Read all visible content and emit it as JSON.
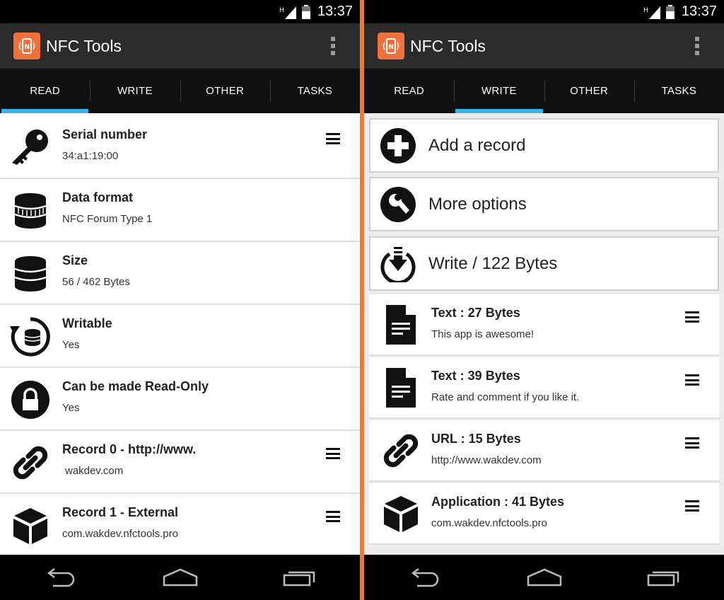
{
  "status": {
    "time": "13:37"
  },
  "app": {
    "title": "NFC Tools",
    "accent": "#f0713a",
    "tab_indicator": "#33b5e5"
  },
  "tabs": [
    "READ",
    "WRITE",
    "OTHER",
    "TASKS"
  ],
  "read_screen": {
    "active_tab": "READ",
    "rows": [
      {
        "icon": "key-icon",
        "title": "Serial number",
        "value": "34:a1:19:00",
        "menu": true
      },
      {
        "icon": "database-icon",
        "title": "Data format",
        "value": "NFC Forum Type 1",
        "menu": false
      },
      {
        "icon": "database-icon",
        "title": "Size",
        "value": "56 / 462 Bytes",
        "menu": false
      },
      {
        "icon": "refresh-database-icon",
        "title": "Writable",
        "value": "Yes",
        "menu": false
      },
      {
        "icon": "lock-icon",
        "title": "Can be made Read-Only",
        "value": "Yes",
        "menu": false
      },
      {
        "icon": "link-icon",
        "title": "Record 0 - http://www.",
        "value": "wakdev.com",
        "menu": true
      },
      {
        "icon": "cube-icon",
        "title": "Record 1 - External",
        "value": "com.wakdev.nfctools.pro",
        "menu": true
      }
    ]
  },
  "write_screen": {
    "active_tab": "WRITE",
    "buttons": [
      {
        "icon": "add-circle-icon",
        "label": "Add a record"
      },
      {
        "icon": "wrench-icon",
        "label": "More options"
      },
      {
        "icon": "download-circle-icon",
        "label": "Write / 122 Bytes"
      }
    ],
    "records": [
      {
        "icon": "document-icon",
        "title": "Text : 27 Bytes",
        "value": "This app is awesome!"
      },
      {
        "icon": "document-icon",
        "title": "Text : 39 Bytes",
        "value": "Rate and comment if you like it."
      },
      {
        "icon": "link-icon",
        "title": "URL : 15 Bytes",
        "value": "http://www.wakdev.com"
      },
      {
        "icon": "cube-icon",
        "title": "Application : 41 Bytes",
        "value": "com.wakdev.nfctools.pro"
      }
    ]
  }
}
